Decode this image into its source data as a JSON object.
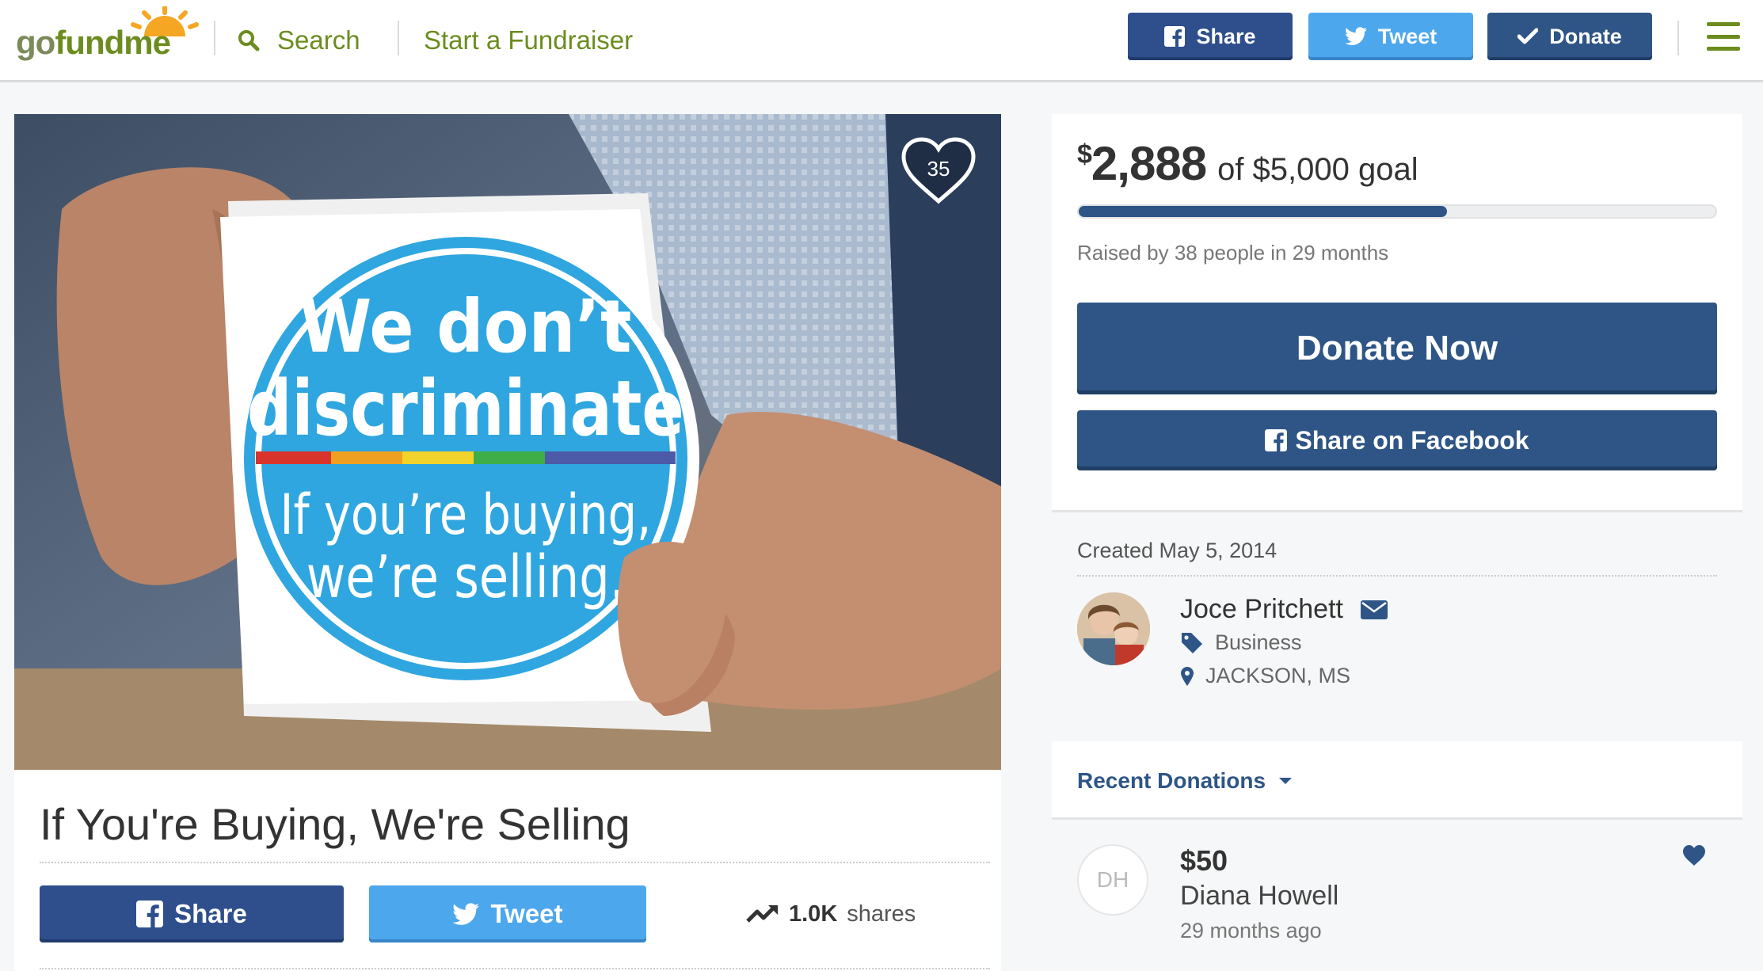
{
  "header": {
    "logo": {
      "go": "go",
      "fund": "fund",
      "me": "me"
    },
    "search_label": "Search",
    "start_label": "Start a Fundraiser",
    "share_label": "Share",
    "tweet_label": "Tweet",
    "donate_label": "Donate"
  },
  "hero": {
    "heart_count": "35",
    "sticker": {
      "line1": "We don’t",
      "line2": "discriminate",
      "line3": "If you’re buying,",
      "line4": "we’re selling."
    }
  },
  "campaign": {
    "title": "If You're Buying, We're Selling",
    "share_label": "Share",
    "tweet_label": "Tweet",
    "shares_count": "1.0K",
    "shares_label": "shares"
  },
  "funding": {
    "raised": "2,888",
    "currency": "$",
    "goal_text": "of $5,000 goal",
    "progress_fraction": 0.578,
    "raised_by": "Raised by 38 people in 29 months",
    "donate_now_label": "Donate Now",
    "share_fb_label": "Share on Facebook"
  },
  "organizer": {
    "created": "Created May 5, 2014",
    "name": "Joce Pritchett",
    "category": "Business",
    "location": "JACKSON, MS"
  },
  "recent": {
    "title": "Recent Donations",
    "items": [
      {
        "initials": "DH",
        "amount": "$50",
        "name": "Diana Howell",
        "time": "29 months ago"
      }
    ]
  },
  "colors": {
    "brand_green": "#6c8c1f",
    "facebook_blue": "#2e4f8c",
    "twitter_blue": "#4da7ec",
    "donate_blue": "#2e5586"
  }
}
